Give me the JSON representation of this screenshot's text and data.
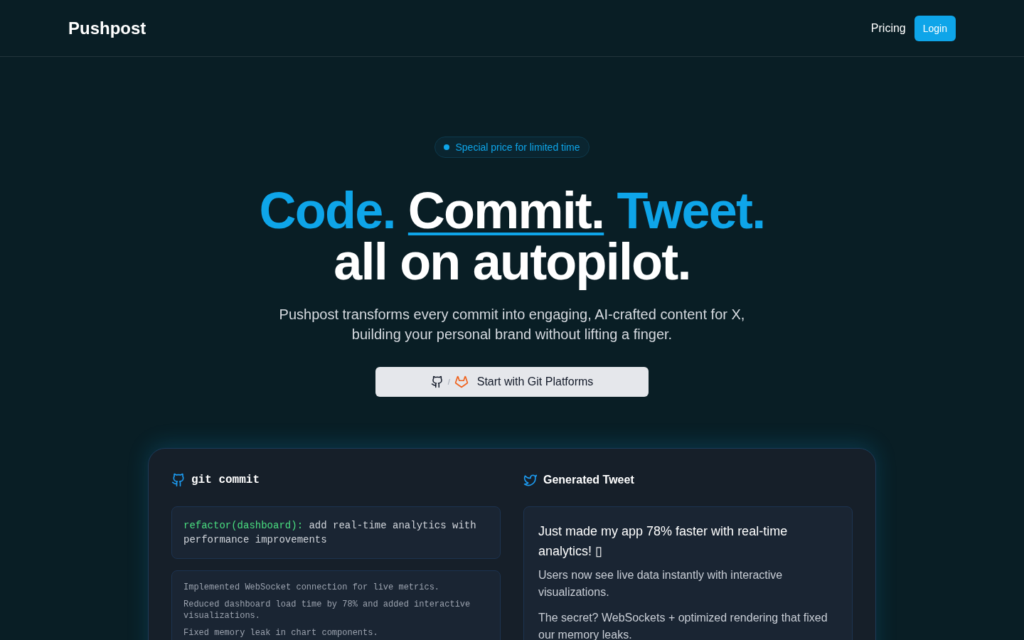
{
  "header": {
    "logo": "Pushpost",
    "nav": [
      {
        "label": "Pricing",
        "kind": "link"
      },
      {
        "label": "Login",
        "kind": "button"
      }
    ]
  },
  "hero": {
    "badge": "Special price for limited time",
    "headline": {
      "words": [
        {
          "text": "Code.",
          "kind": "accent"
        },
        {
          "text": "Commit.",
          "kind": "underlined"
        },
        {
          "text": "Tweet.",
          "kind": "accent"
        }
      ],
      "line_2": "all on autopilot."
    },
    "subtitle": "Pushpost transforms every commit into engaging, AI-crafted content for X, building your personal brand without lifting a finger.",
    "cta": {
      "separator": "/",
      "label": "Start with Git Platforms"
    }
  },
  "demo": {
    "commit_panel": {
      "title": "git commit",
      "type": "refactor(dashboard):",
      "message": "add real-time analytics with performance improvements",
      "details": [
        "Implemented WebSocket connection for live metrics.",
        "Reduced dashboard load time by 78% and added interactive visualizations.",
        "Fixed memory leak in chart components."
      ]
    },
    "tweet_panel": {
      "title": "Generated Tweet",
      "lead": "Just made my app 78% faster with real-time analytics! ▯",
      "body": [
        "Users now see live data instantly with interactive visualizations.",
        "The secret? WebSockets + optimized rendering that fixed our memory leaks."
      ]
    }
  }
}
